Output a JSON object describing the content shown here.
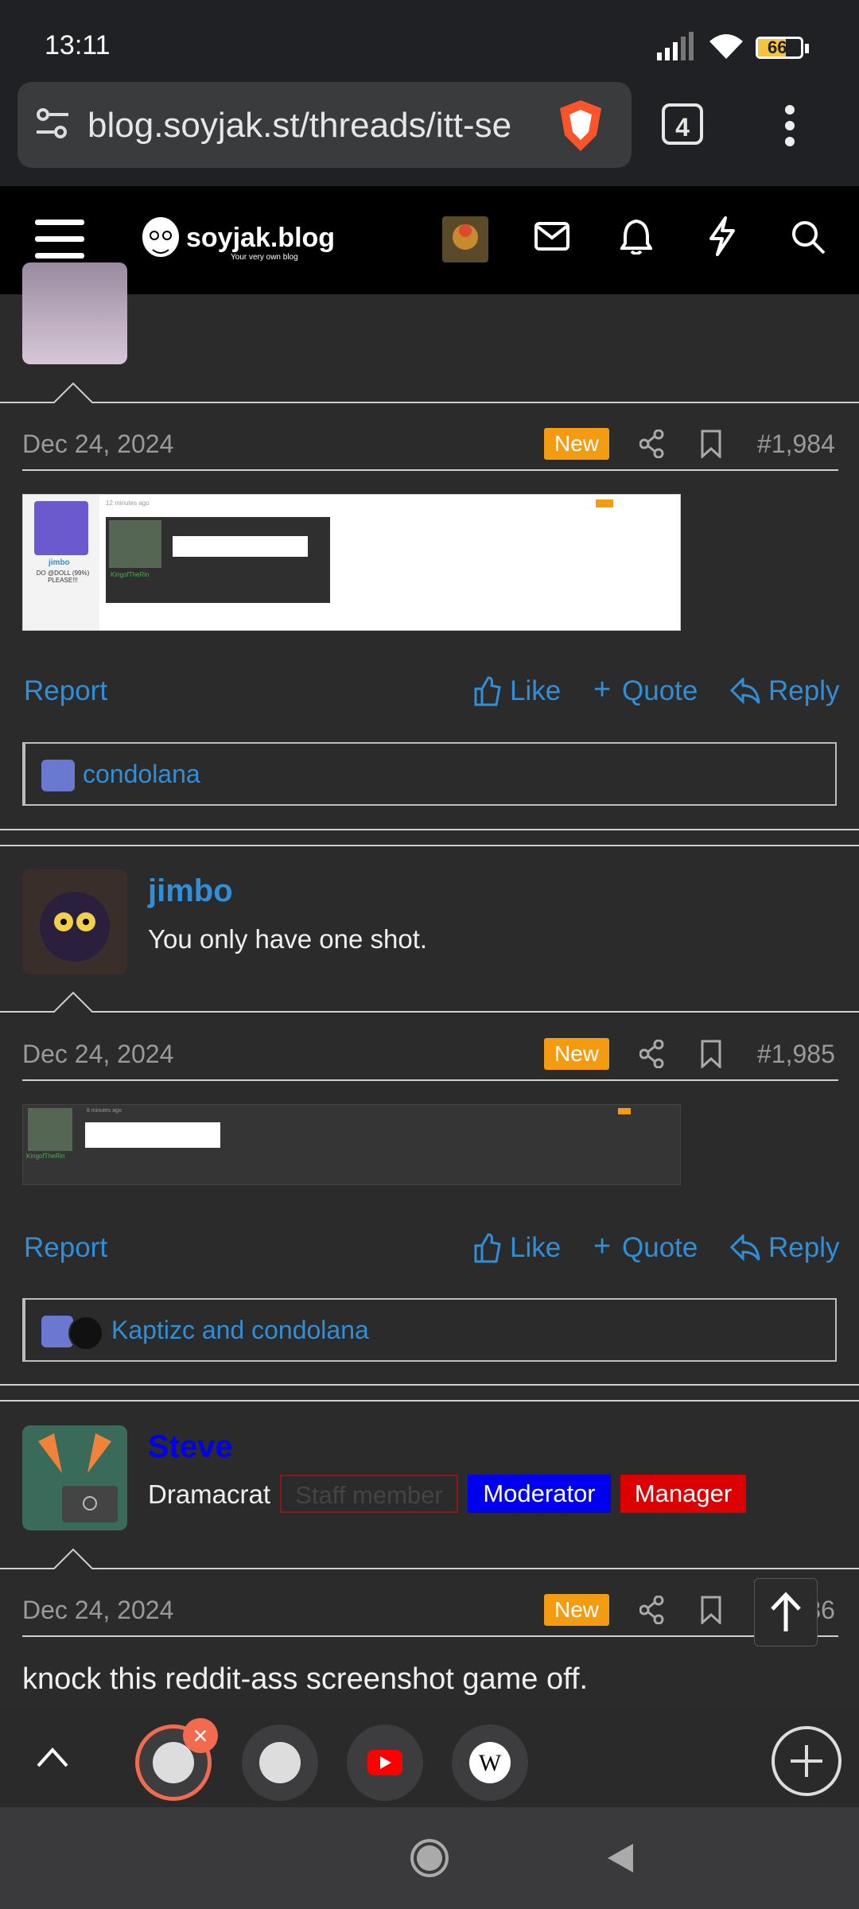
{
  "status": {
    "time": "13:11",
    "battery": "66"
  },
  "browser": {
    "url": "blog.soyjak.st/threads/itt-se",
    "tab_count": "4"
  },
  "site": {
    "title": "soyjak.blog",
    "tagline": "Your very own blog"
  },
  "posts": [
    {
      "date": "Dec 24, 2024",
      "badge": "New",
      "number": "#1,984",
      "actions": {
        "report": "Report",
        "like": "Like",
        "quote": "Quote",
        "reply": "Reply"
      },
      "likes": "condolana",
      "thumb": {
        "user": "jimbo",
        "caption": "DO @DOLL (99%) PLEASE!!!",
        "time": "12 minutes ago",
        "inner_user": "KingofTheRin"
      }
    },
    {
      "author": "jimbo",
      "message": "You only have one shot.",
      "date": "Dec 24, 2024",
      "badge": "New",
      "number": "#1,985",
      "actions": {
        "report": "Report",
        "like": "Like",
        "quote": "Quote",
        "reply": "Reply"
      },
      "likes": "Kaptizc and condolana",
      "thumb": {
        "user": "KingofTheRin",
        "time": "8 minutes ago"
      }
    },
    {
      "author": "Steve",
      "title": "Dramacrat",
      "roles": [
        "Staff member",
        "Moderator",
        "Manager"
      ],
      "date": "Dec 24, 2024",
      "badge": "New",
      "number": "#1,986",
      "message": "knock this reddit-ass screenshot game off."
    }
  ],
  "colors": {
    "link": "#2f8fd8",
    "new_badge": "#f39c12",
    "moderator": "#0000ee",
    "manager": "#dd0000",
    "steve": "#0000ee"
  }
}
